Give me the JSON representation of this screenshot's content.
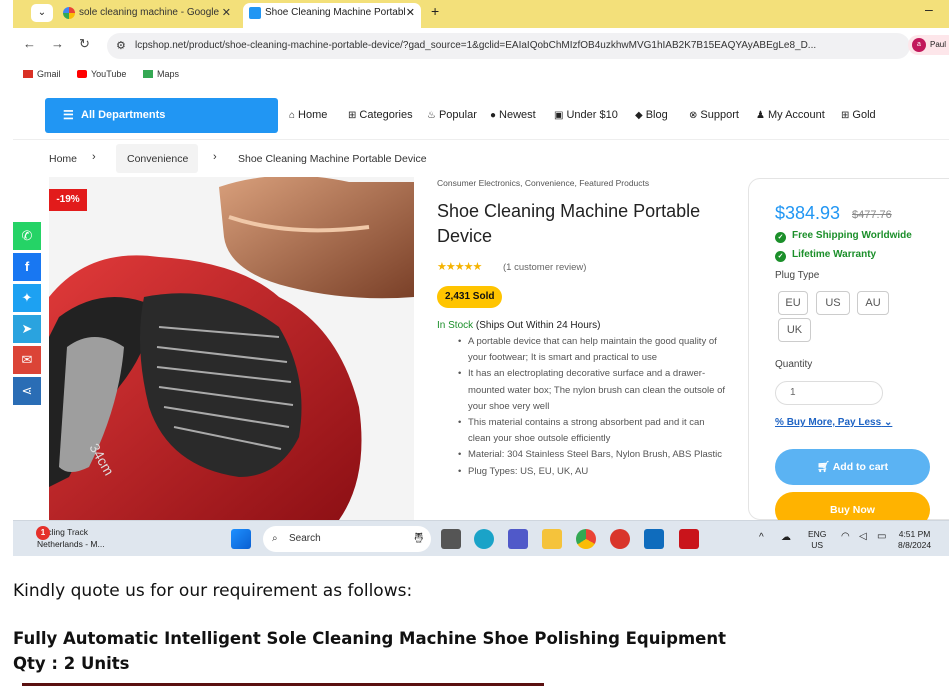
{
  "browser": {
    "tabs": [
      {
        "title": "sole cleaning machine - Google",
        "active": false
      },
      {
        "title": "Shoe Cleaning Machine Portabl",
        "active": true
      }
    ],
    "url": "lcpshop.net/product/shoe-cleaning-machine-portable-device/?gad_source=1&gclid=EAIaIQobChMIzfOB4uzkhwMVG1hIAB2K7B15EAQYAyABEgLe8_D...",
    "profile_name": "Paul",
    "profile_initial": "a",
    "bookmarks": [
      "Gmail",
      "YouTube",
      "Maps"
    ]
  },
  "site": {
    "all_departments": "All Departments",
    "menu": [
      "Home",
      "Categories",
      "Popular",
      "Newest",
      "Under $10",
      "Blog",
      "Support",
      "My Account",
      "Gold"
    ],
    "breadcrumb": [
      "Home",
      "Convenience",
      "Shoe Cleaning Machine Portable Device"
    ]
  },
  "product": {
    "discount_badge": "-19%",
    "categories": "Consumer Electronics, Convenience, Featured Products",
    "title": "Shoe Cleaning Machine Portable Device",
    "rating_stars": 5,
    "review_text": "(1 customer review)",
    "sold": "2,431 Sold",
    "stock_status": "In Stock",
    "stock_note": "(Ships Out Within 24 Hours)",
    "features": [
      "A portable device that can help maintain the good quality of your footwear; It is smart and practical to use",
      "It has an electroplating decorative surface and a drawer-mounted water box; The nylon brush can clean the outsole of your shoe very well",
      "This material contains a strong absorbent pad and it can clean your shoe outsole efficiently",
      "Material: 304 Stainless Steel Bars, Nylon Brush, ABS Plastic",
      "Plug Types: US, EU, UK, AU"
    ],
    "image_caption": "34cm"
  },
  "buybox": {
    "price": "$384.93",
    "old_price": "$477.76",
    "perks": [
      "Free Shipping Worldwide",
      "Lifetime Warranty"
    ],
    "plug_label": "Plug Type",
    "plug_options": [
      "EU",
      "US",
      "AU",
      "UK"
    ],
    "quantity_label": "Quantity",
    "quantity_value": "1",
    "pay_more": "Buy More, Pay Less",
    "add_to_cart": "Add to cart",
    "buy_now": "Buy Now"
  },
  "taskbar": {
    "weather_title": "Cycling Track",
    "weather_sub": "Netherlands - M...",
    "weather_badge": "1",
    "search_placeholder": "Search",
    "lang": "ENG",
    "region": "US",
    "time": "4:51 PM",
    "date": "8/8/2024"
  },
  "email": {
    "line1": "Kindly quote us for our requirement as follows:",
    "line2": "Fully Automatic Intelligent Sole Cleaning Machine Shoe Polishing Equipment",
    "line3": "Qty : 2 Units"
  },
  "colors": {
    "accent": "#2196f3",
    "tabbar": "#f3e07a",
    "sale": "#e21b1b",
    "sold_badge": "#ffc400",
    "in_stock": "#1b8f2a",
    "buy_now": "#ffb300"
  }
}
